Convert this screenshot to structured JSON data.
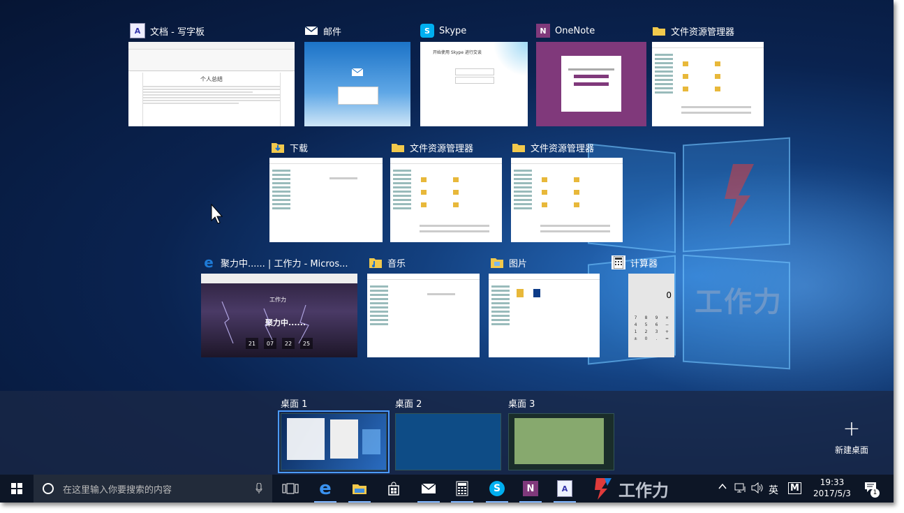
{
  "windows": {
    "wordpad": {
      "title": "文档 - 写字板",
      "doc_heading": "个人总结"
    },
    "mail": {
      "title": "邮件"
    },
    "skype": {
      "title": "Skype",
      "doc_heading": "开始使用 Skype 进行交谈"
    },
    "onenote": {
      "title": "OneNote"
    },
    "explorer1": {
      "title": "文件资源管理器"
    },
    "downloads": {
      "title": "下载"
    },
    "explorer2": {
      "title": "文件资源管理器"
    },
    "explorer3": {
      "title": "文件资源管理器"
    },
    "edge": {
      "title": "聚力中...... | 工作力 - Micros...",
      "brand": "工作力",
      "hero": "聚力中......",
      "countdown": [
        "21",
        "07",
        "22",
        "25"
      ]
    },
    "music": {
      "title": "音乐"
    },
    "pictures": {
      "title": "图片"
    },
    "calculator": {
      "title": "计算器",
      "display": "0",
      "keys": [
        "7",
        "8",
        "9",
        "×",
        "4",
        "5",
        "6",
        "−",
        "1",
        "2",
        "3",
        "+",
        "±",
        "0",
        ".",
        "="
      ]
    }
  },
  "virtual_desktops": {
    "desktops": [
      {
        "label": "桌面 1"
      },
      {
        "label": "桌面 2"
      },
      {
        "label": "桌面 3"
      }
    ],
    "new_desktop_label": "新建桌面"
  },
  "watermark": {
    "text": "工作力"
  },
  "taskbar": {
    "search_placeholder": "在这里输入你要搜索的内容",
    "tray": {
      "ime": "英",
      "ime_mode": "M",
      "time": "19:33",
      "date": "2017/5/3",
      "notifications": "1"
    }
  },
  "colors": {
    "accent": "#4b9bff",
    "onenote": "#80397b",
    "skype": "#00aff0",
    "edge": "#1e7bd7"
  }
}
